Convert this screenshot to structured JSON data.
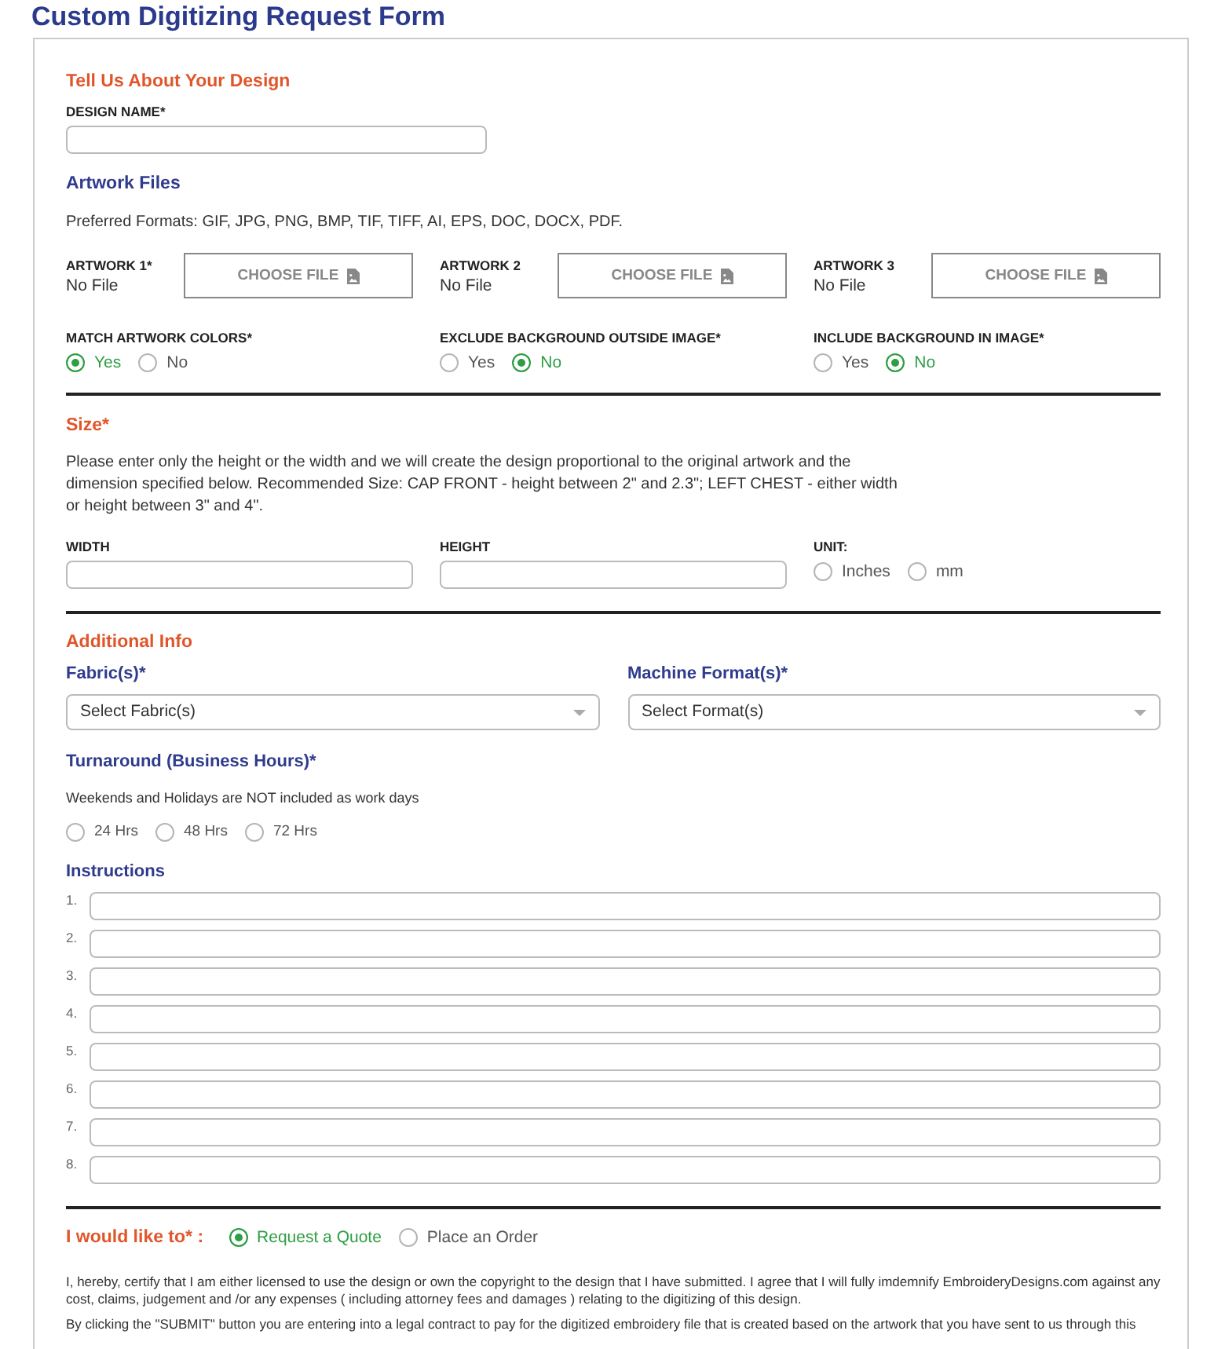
{
  "page_title": "Custom Digitizing Request Form",
  "design": {
    "heading": "Tell Us About Your Design",
    "name_label": "DESIGN NAME*"
  },
  "artwork": {
    "heading": "Artwork Files",
    "formats": "Preferred Formats: GIF, JPG, PNG, BMP, TIF, TIFF, AI, EPS, DOC, DOCX, PDF.",
    "files": [
      {
        "label": "ARTWORK 1*",
        "status": "No File",
        "button": "CHOOSE FILE"
      },
      {
        "label": "ARTWORK 2",
        "status": "No File",
        "button": "CHOOSE FILE"
      },
      {
        "label": "ARTWORK 3",
        "status": "No File",
        "button": "CHOOSE FILE"
      }
    ],
    "options": [
      {
        "label": "MATCH ARTWORK COLORS*",
        "choices": [
          {
            "label": "Yes",
            "selected": true
          },
          {
            "label": "No",
            "selected": false
          }
        ]
      },
      {
        "label": "EXCLUDE BACKGROUND OUTSIDE IMAGE*",
        "choices": [
          {
            "label": "Yes",
            "selected": false
          },
          {
            "label": "No",
            "selected": true
          }
        ]
      },
      {
        "label": "INCLUDE BACKGROUND IN IMAGE*",
        "choices": [
          {
            "label": "Yes",
            "selected": false
          },
          {
            "label": "No",
            "selected": true
          }
        ]
      }
    ]
  },
  "size": {
    "heading": "Size*",
    "note": "Please enter only the height or the width and we will create the design proportional to the original artwork and the dimension specified below. Recommended Size: CAP FRONT - height between 2\" and 2.3\"; LEFT CHEST - either width or height between 3\" and 4\".",
    "fields": [
      {
        "label": "WIDTH"
      },
      {
        "label": "HEIGHT"
      }
    ],
    "unit": {
      "label": "UNIT:",
      "choices": [
        {
          "label": "Inches",
          "selected": false
        },
        {
          "label": "mm",
          "selected": false
        }
      ]
    }
  },
  "additional_info": {
    "heading": "Additional Info",
    "selects": [
      {
        "label": "Fabric(s)*",
        "placeholder": "Select Fabric(s)"
      },
      {
        "label": "Machine Format(s)*",
        "placeholder": "Select Format(s)"
      }
    ],
    "turnaround": {
      "label": "Turnaround (Business Hours)*",
      "note": "Weekends and Holidays are NOT included as work days",
      "choices": [
        {
          "label": "24 Hrs",
          "selected": false
        },
        {
          "label": "48 Hrs",
          "selected": false
        },
        {
          "label": "72 Hrs",
          "selected": false
        }
      ]
    },
    "instructions": {
      "label": "Instructions",
      "lines": [
        {
          "number": "1."
        },
        {
          "number": "2."
        },
        {
          "number": "3."
        },
        {
          "number": "4."
        },
        {
          "number": "5."
        },
        {
          "number": "6."
        },
        {
          "number": "7."
        },
        {
          "number": "8."
        }
      ]
    }
  },
  "request_type": {
    "label": "I would like to* :",
    "choices": [
      {
        "label": "Request a Quote",
        "selected": true
      },
      {
        "label": "Place an Order",
        "selected": false
      }
    ]
  },
  "legal": [
    "I, hereby, certify that I am either licensed to use the design or own the copyright to the design that I have submitted. I agree that I will fully imdemnify EmbroideryDesigns.com against any cost, claims, judgement and /or any expenses ( including attorney fees and damages ) relating to the digitizing of this design.",
    "By clicking the \"SUBMIT\" button you are entering into a legal contract to pay for the digitized embroidery file that is created based on the artwork that you have sent to us through this"
  ]
}
